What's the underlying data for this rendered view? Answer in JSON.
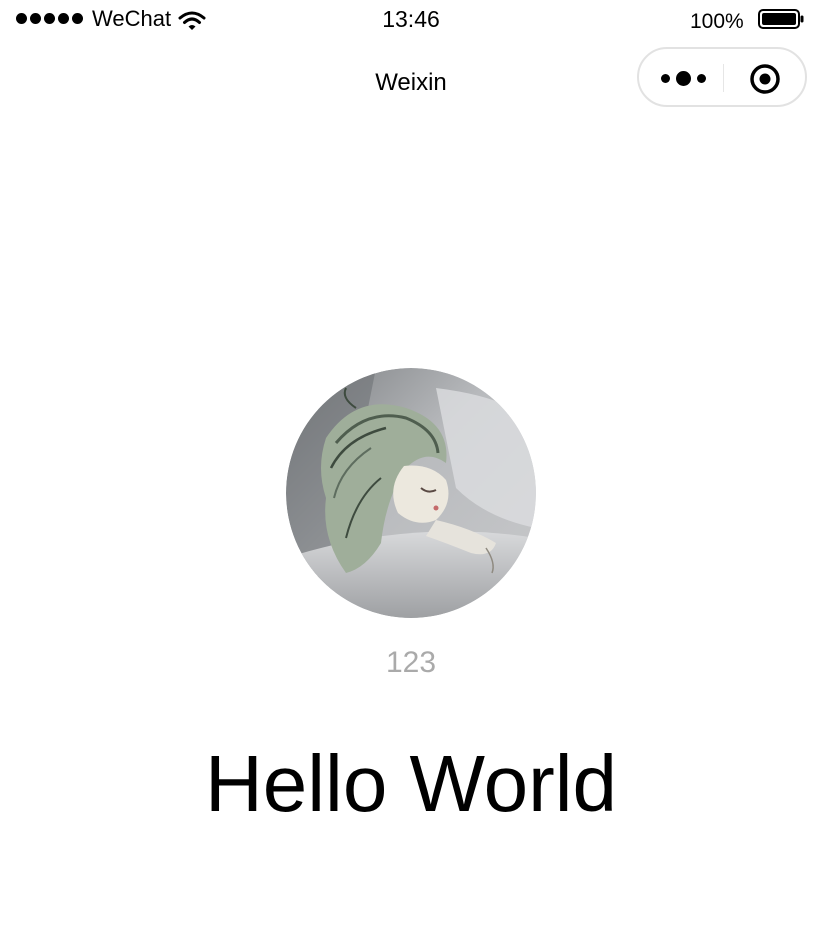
{
  "status_bar": {
    "carrier": "WeChat",
    "time": "13:46",
    "battery_percent": "100%",
    "battery_level": 1.0,
    "signal_bars": 5,
    "icons": [
      "signal-dots-icon",
      "wifi-icon",
      "battery-icon"
    ]
  },
  "nav": {
    "title": "Weixin",
    "capsule_icons": [
      "more-dots-icon",
      "close-target-icon"
    ]
  },
  "profile": {
    "avatar": "user-avatar-illustration",
    "nickname": "123"
  },
  "main": {
    "greeting": "Hello World"
  },
  "colors": {
    "background": "#ffffff",
    "text": "#000000",
    "nickname_text": "#aaaaaa",
    "capsule_border": "#e2e2e2"
  }
}
